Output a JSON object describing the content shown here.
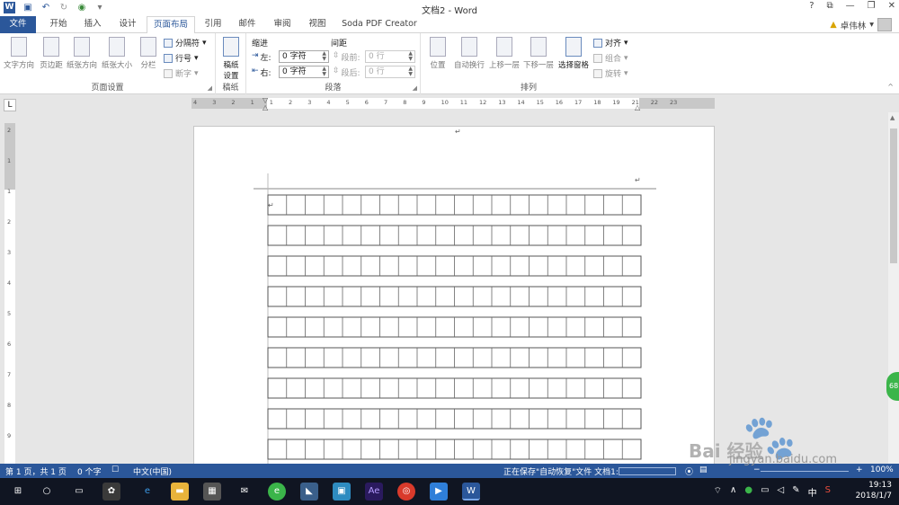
{
  "title": "文档2 - Word",
  "qat_icons": [
    "save-icon",
    "undo-icon",
    "redo-icon",
    "autosave-icon"
  ],
  "window_controls": [
    "?",
    "⧉",
    "—",
    "❐",
    "✕"
  ],
  "tabs": {
    "file": "文件",
    "items": [
      "开始",
      "插入",
      "设计",
      "页面布局",
      "引用",
      "邮件",
      "审阅",
      "视图",
      "Soda PDF Creator"
    ],
    "active": "页面布局"
  },
  "user": {
    "name": "卓伟林",
    "arrow": "▾"
  },
  "ribbon": {
    "page_setup": {
      "label": "页面设置",
      "buttons": [
        "文字方向",
        "页边距",
        "纸张方向",
        "纸张大小",
        "分栏"
      ],
      "small": [
        "分隔符",
        "行号",
        "断字"
      ]
    },
    "manuscript": {
      "label": "稿纸",
      "button": "稿纸\n设置",
      "button_line1": "稿纸",
      "button_line2": "设置"
    },
    "paragraph": {
      "label": "段落",
      "indent_title": "缩进",
      "spacing_title": "间距",
      "left_label": "左:",
      "right_label": "右:",
      "before_label": "段前:",
      "after_label": "段后:",
      "left_value": "0 字符",
      "right_value": "0 字符",
      "before_value": "0 行",
      "after_value": "0 行"
    },
    "arrange": {
      "label": "排列",
      "buttons": [
        "位置",
        "自动换行",
        "上移一层",
        "下移一层",
        "选择窗格"
      ],
      "small": [
        "对齐",
        "组合",
        "旋转"
      ]
    }
  },
  "ruler": {
    "corner": "L",
    "h_ticks": [
      "4",
      "3",
      "2",
      "1",
      "1",
      "2",
      "3",
      "4",
      "5",
      "6",
      "7",
      "8",
      "9",
      "10",
      "11",
      "12",
      "13",
      "14",
      "15",
      "16",
      "17",
      "18",
      "19",
      "21",
      "22",
      "23"
    ],
    "v_ticks": [
      "2",
      "1",
      "1",
      "2",
      "3",
      "4",
      "5",
      "6",
      "7",
      "8",
      "9",
      "10"
    ]
  },
  "document": {
    "para_mark": "↵",
    "grid_rows": 9,
    "grid_cols": 20
  },
  "status": {
    "page": "第 1 页，共 1 页",
    "words": "0 个字",
    "lang": "中文(中国)",
    "saving": "正在保存\"自动恢复\"文件 文档1:",
    "zoom": "100%"
  },
  "taskbar": {
    "time": "19:13",
    "date": "2018/1/7",
    "ime": "中",
    "apps": [
      "windows-icon",
      "cortana-icon",
      "taskview-icon",
      "app1-icon",
      "edge-icon",
      "explorer-icon",
      "store-icon",
      "mail-icon",
      "browser-icon",
      "app2-icon",
      "app3-icon",
      "ae-icon",
      "music-icon",
      "play-icon",
      "word-icon"
    ]
  },
  "watermark": {
    "text": "jingyan.baidu.com",
    "brand": "Bai 经验"
  },
  "side_badge": "68"
}
